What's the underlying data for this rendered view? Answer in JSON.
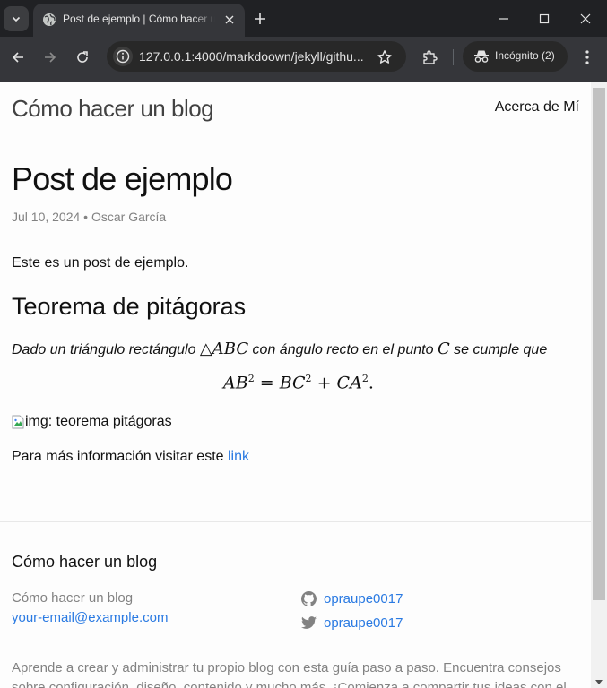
{
  "browser": {
    "tab_title": "Post de ejemplo | Cómo hacer un blog",
    "url": "127.0.0.1:4000/markdoown/jekyll/githu...",
    "incognito_label": "Incógnito (2)"
  },
  "site": {
    "title": "Cómo hacer un blog",
    "nav_link": "Acerca de Mí"
  },
  "post": {
    "title": "Post de ejemplo",
    "meta": "Jul 10, 2024 • Oscar García",
    "intro": "Este es un post de ejemplo.",
    "heading": "Teorema de pitágoras",
    "theorem_part1": "Dado un triángulo rectángulo ",
    "theorem_math1": "△ABC",
    "theorem_part2": " con ángulo recto en el punto ",
    "theorem_math2": "C",
    "theorem_part3": " se cumple que",
    "image_alt": "img: teorema pitágoras",
    "more_info_text": "Para más información visitar este ",
    "link_text": "link"
  },
  "footer": {
    "heading": "Cómo hacer un blog",
    "col1_title": "Cómo hacer un blog",
    "email": "your-email@example.com",
    "github_user": "opraupe0017",
    "twitter_user": "opraupe0017",
    "description": "Aprende a crear y administrar tu propio blog con esta guía paso a paso. Encuentra consejos sobre configuración, diseño, contenido y mucho más. ¡Comienza a compartir tus ideas con el mundo!"
  },
  "colors": {
    "link": "#2a7ae2",
    "chrome_dark": "#202124",
    "toolbar": "#35363a"
  }
}
